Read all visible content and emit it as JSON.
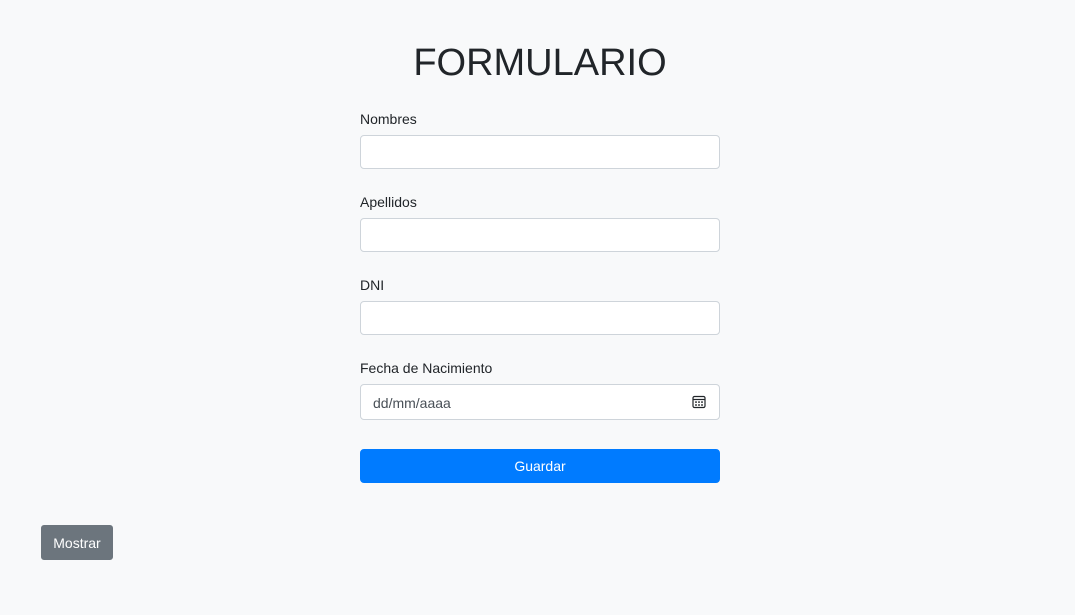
{
  "form": {
    "title": "FORMULARIO",
    "fields": [
      {
        "label": "Nombres",
        "value": ""
      },
      {
        "label": "Apellidos",
        "value": ""
      },
      {
        "label": "DNI",
        "value": ""
      }
    ],
    "birthdate": {
      "label": "Fecha de Nacimiento",
      "placeholder": "dd/mm/aaaa",
      "icon": "calendar-icon"
    },
    "submit_label": "Guardar"
  },
  "show_button_label": "Mostrar",
  "colors": {
    "background": "#f8f9fa",
    "primary": "#007bff",
    "secondary": "#6c757d",
    "input_border": "#ced4da"
  }
}
